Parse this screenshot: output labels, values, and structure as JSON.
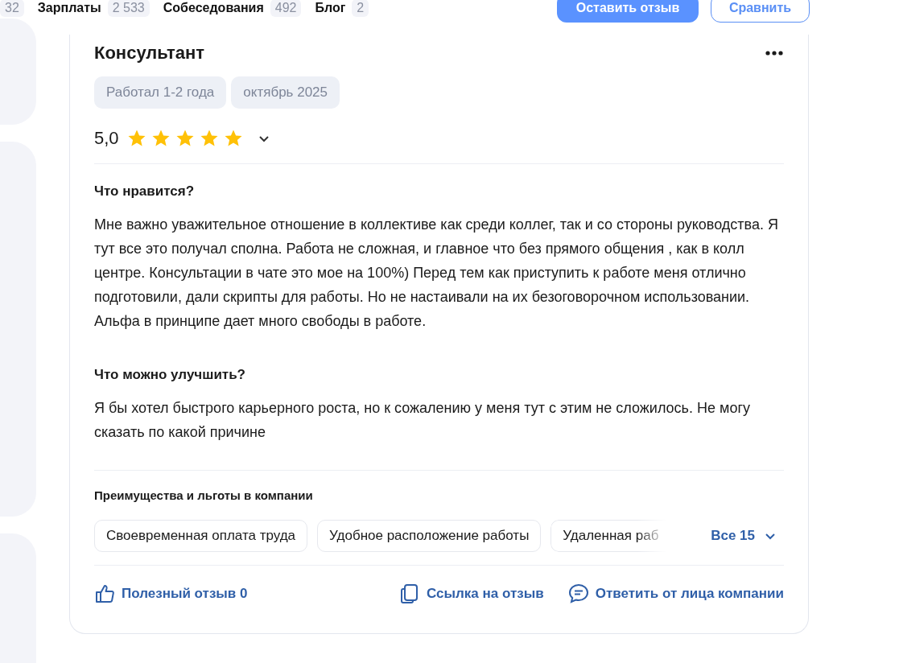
{
  "nav_tabs": [
    {
      "count": "32"
    },
    {
      "label": "Зарплаты",
      "count": "2 533"
    },
    {
      "label": "Собеседования",
      "count": "492"
    },
    {
      "label": "Блог",
      "count": "2"
    }
  ],
  "actions": [
    {
      "label": "Оставить отзыв",
      "kind": "primary"
    },
    {
      "label": "Сравнить",
      "kind": "outline"
    }
  ],
  "review": {
    "title": "Консультант",
    "tags": [
      "Работал 1-2 года",
      "октябрь 2025"
    ],
    "rating": "5,0",
    "stars": 5,
    "sections": [
      {
        "heading": "Что нравится?",
        "text": "Мне важно уважительное отношение в коллективе как среди коллег, так и со стороны руководства. Я тут все это получал сполна. Работа не сложная, и главное что без прямого общения , как в колл центре. Консультации в чате это мое на 100%) Перед тем как приступить к работе меня отлично подготовили, дали скрипты для работы. Но не настаивали на их безоговорочном использовании. Альфа в принципе дает много свободы в работе."
      },
      {
        "heading": "Что можно улучшить?",
        "text": "Я бы хотел быстрого карьерного роста, но к сожалению у меня тут с этим не сложилось. Не могу сказать по какой причине"
      }
    ],
    "benefits": {
      "heading": "Преимущества и льготы в компании",
      "items": [
        "Своевременная оплата труда",
        "Удобное расположение работы",
        "Удаленная раб"
      ],
      "more": "Все 15"
    },
    "footer": {
      "helpful": "Полезный отзыв 0",
      "link": "Ссылка на отзыв",
      "reply": "Ответить от лица компании"
    }
  }
}
